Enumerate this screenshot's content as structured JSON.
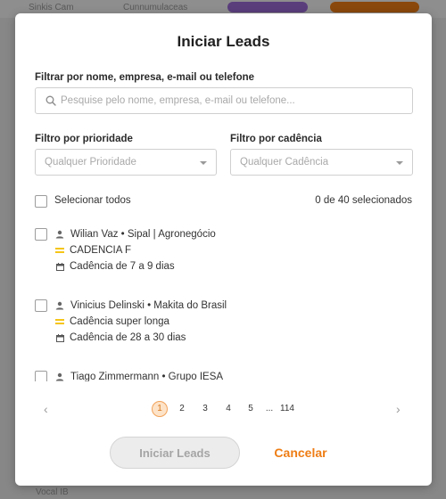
{
  "background": {
    "tabs": [
      {
        "label": "Sinkis Cam",
        "color": "#d8d8d8"
      },
      {
        "label": "Cunnumulaceas",
        "color": "#d8d8d8"
      },
      {
        "label": "",
        "color": "#9b6bd6"
      },
      {
        "label": "",
        "color": "#ee7d15"
      }
    ],
    "footer_text": "Vocal IB"
  },
  "modal": {
    "title": "Iniciar Leads",
    "search": {
      "label": "Filtrar por nome, empresa, e-mail ou telefone",
      "placeholder": "Pesquise pelo nome, empresa, e-mail ou telefone...",
      "value": ""
    },
    "priority_filter": {
      "label": "Filtro por prioridade",
      "selected": "Qualquer Prioridade"
    },
    "cadence_filter": {
      "label": "Filtro por cadência",
      "selected": "Qualquer Cadência"
    },
    "select_all": {
      "label": "Selecionar todos",
      "checked": false
    },
    "selection_count": "0 de 40 selecionados",
    "leads": [
      {
        "name": "Wilian Vaz • Sipal | Agronegócio",
        "cadence": "CADENCIA F",
        "duration": "Cadência de 7 a 9 dias",
        "checked": false
      },
      {
        "name": "Vinicius Delinski • Makita do Brasil",
        "cadence": "Cadência super longa",
        "duration": "Cadência de 28 a 30 dias",
        "checked": false
      },
      {
        "name": "Tiago Zimmermann • Grupo IESA",
        "cadence": "",
        "duration": "",
        "checked": false
      }
    ],
    "pagination": {
      "prev": "‹",
      "next": "›",
      "pages": [
        "1",
        "2",
        "3",
        "4",
        "5",
        "...",
        "114"
      ],
      "current": "1"
    },
    "start_button": "Iniciar Leads",
    "cancel_button": "Cancelar"
  },
  "colors": {
    "accent": "#ee7d15",
    "cadence_marker": "#f5c518",
    "active_page_bg": "#fde3c8"
  },
  "icons": {
    "search": "search-icon",
    "person": "person-icon",
    "cadence": "cadence-lines-icon",
    "calendar": "calendar-icon",
    "caret": "chevron-down-icon"
  }
}
